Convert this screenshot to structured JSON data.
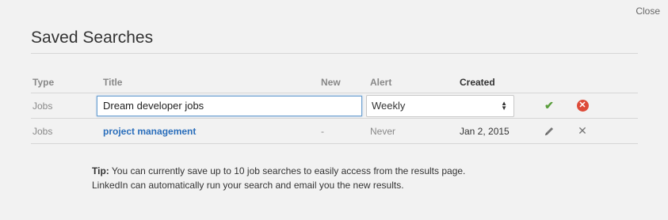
{
  "close_label": "Close",
  "dialog_title": "Saved Searches",
  "columns": {
    "type": "Type",
    "title": "Title",
    "new": "New",
    "alert": "Alert",
    "created": "Created"
  },
  "edit_row": {
    "type": "Jobs",
    "title_value": "Dream developer jobs",
    "alert_value": "Weekly",
    "save_icon": "check-icon",
    "cancel_icon": "cancel-circle-icon"
  },
  "rows": [
    {
      "type": "Jobs",
      "title": "project management",
      "new": "-",
      "alert": "Never",
      "created": "Jan 2, 2015",
      "edit_icon": "pencil-icon",
      "delete_icon": "x-icon"
    }
  ],
  "tip": {
    "label": "Tip:",
    "line1": "You can currently save up to 10 job searches to easily access from the results page.",
    "line2": "LinkedIn can automatically run your search and email you the new results."
  },
  "colors": {
    "link": "#2a6ebb",
    "save": "#5a9e3c",
    "cancel": "#dd4b39",
    "background": "#f2f2f2"
  }
}
